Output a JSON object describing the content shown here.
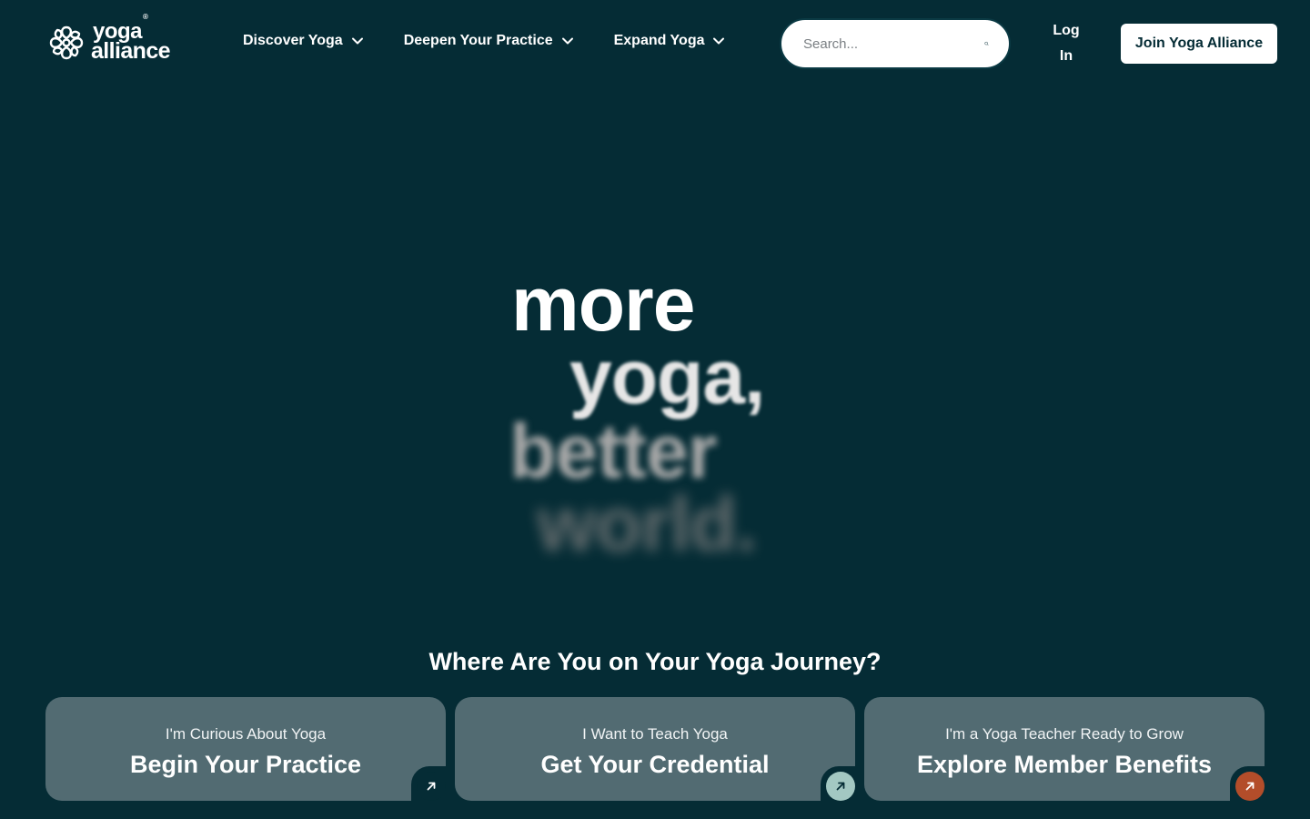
{
  "brand": {
    "word1": "yoga",
    "registered": "®",
    "word2": "alliance",
    "icon": "yoga-alliance-logo-icon"
  },
  "nav": {
    "items": [
      {
        "label": "Discover Yoga",
        "icon": "chevron-down-icon"
      },
      {
        "label": "Deepen Your Practice",
        "icon": "chevron-down-icon"
      },
      {
        "label": "Expand Yoga",
        "icon": "chevron-down-icon"
      }
    ]
  },
  "search": {
    "placeholder": "Search...",
    "value": "",
    "icon": "search-icon"
  },
  "auth": {
    "login_label": "Log In",
    "join_label": "Join Yoga Alliance"
  },
  "hero": {
    "lines": [
      "more",
      "yoga,",
      "better",
      "world."
    ]
  },
  "journey": {
    "title": "Where Are You on Your Yoga Journey?",
    "cards": [
      {
        "subtitle": "I'm Curious About Yoga",
        "title": "Begin Your Practice",
        "icon": "arrow-up-right-icon",
        "accent": "#052c35"
      },
      {
        "subtitle": "I Want to Teach Yoga",
        "title": "Get Your Credential",
        "icon": "arrow-up-right-icon",
        "accent": "#a3c8c2"
      },
      {
        "subtitle": "I'm a Yoga Teacher Ready to Grow",
        "title": "Explore Member Benefits",
        "icon": "arrow-up-right-icon",
        "accent": "#b34d2a"
      }
    ]
  },
  "colors": {
    "background": "#052c35",
    "card": "#526b72",
    "button_text": "#052c35"
  }
}
